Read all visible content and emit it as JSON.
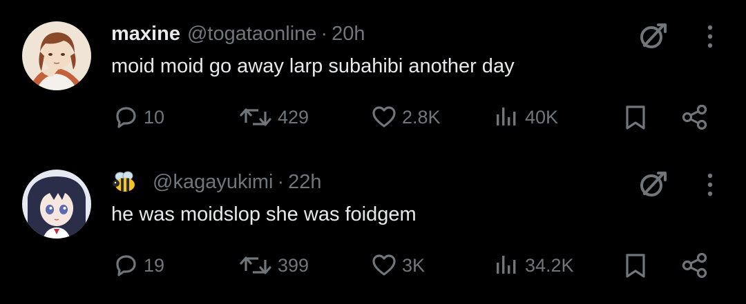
{
  "colors": {
    "background": "#000000",
    "primary_text": "#e7e9ea",
    "secondary_text": "#71767b"
  },
  "posts": [
    {
      "display_name": "maxine",
      "name_emoji": "",
      "handle": "@togataonline",
      "separator": "·",
      "time": "20h",
      "text": "moid moid go away larp subahibi another day",
      "stats": {
        "replies": "10",
        "reposts": "429",
        "likes": "2.8K",
        "views": "40K"
      },
      "icons": [
        "avatar",
        "grok-icon",
        "more-icon",
        "reply-icon",
        "repost-icon",
        "like-icon",
        "views-icon",
        "bookmark-icon",
        "share-icon"
      ]
    },
    {
      "display_name": "",
      "name_emoji": "bee-emoji",
      "handle": "@kagayukimi",
      "separator": "·",
      "time": "22h",
      "text": "he was moidslop she was foidgem",
      "stats": {
        "replies": "19",
        "reposts": "399",
        "likes": "3K",
        "views": "34.2K"
      },
      "icons": [
        "avatar",
        "grok-icon",
        "more-icon",
        "reply-icon",
        "repost-icon",
        "like-icon",
        "views-icon",
        "bookmark-icon",
        "share-icon"
      ]
    }
  ]
}
